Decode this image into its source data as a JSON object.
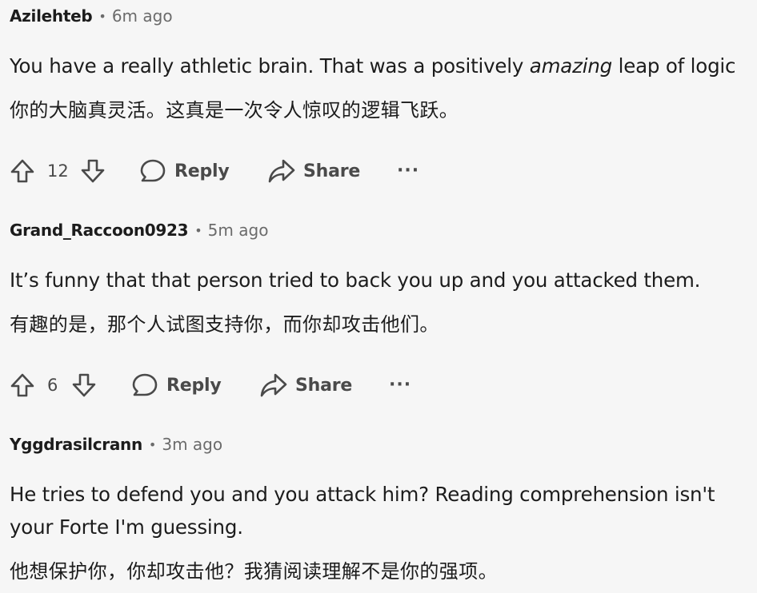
{
  "comments": [
    {
      "author": "Azilehteb",
      "time": "6m ago",
      "text_before_em": "You have a really athletic brain. That was a positively ",
      "text_em": "amazing",
      "text_after_em": " leap of logic",
      "translation": "你的大脑真灵活。这真是一次令人惊叹的逻辑飞跃。",
      "votes": "12",
      "reply_label": "Reply",
      "share_label": "Share",
      "more_label": "···"
    },
    {
      "author": "Grand_Raccoon0923",
      "time": "5m ago",
      "text": "It’s funny that that person tried to back you up and you attacked them.",
      "translation": "有趣的是，那个人试图支持你，而你却攻击他们。",
      "votes": "6",
      "reply_label": "Reply",
      "share_label": "Share",
      "more_label": "···"
    },
    {
      "author": "Yggdrasilcrann",
      "time": "3m ago",
      "text_line1": "He tries to defend you and you attack him? Reading comprehension isn't",
      "text_line2": "your Forte I'm guessing.",
      "translation": "他想保护你，你却攻击他？我猜阅读理解不是你的强项。"
    }
  ],
  "meta_separator": "•",
  "icons": {
    "upvote": "upvote-arrow-icon",
    "downvote": "downvote-arrow-icon",
    "reply": "speech-bubble-icon",
    "share": "share-arrow-icon",
    "more": "more-dots-icon"
  }
}
